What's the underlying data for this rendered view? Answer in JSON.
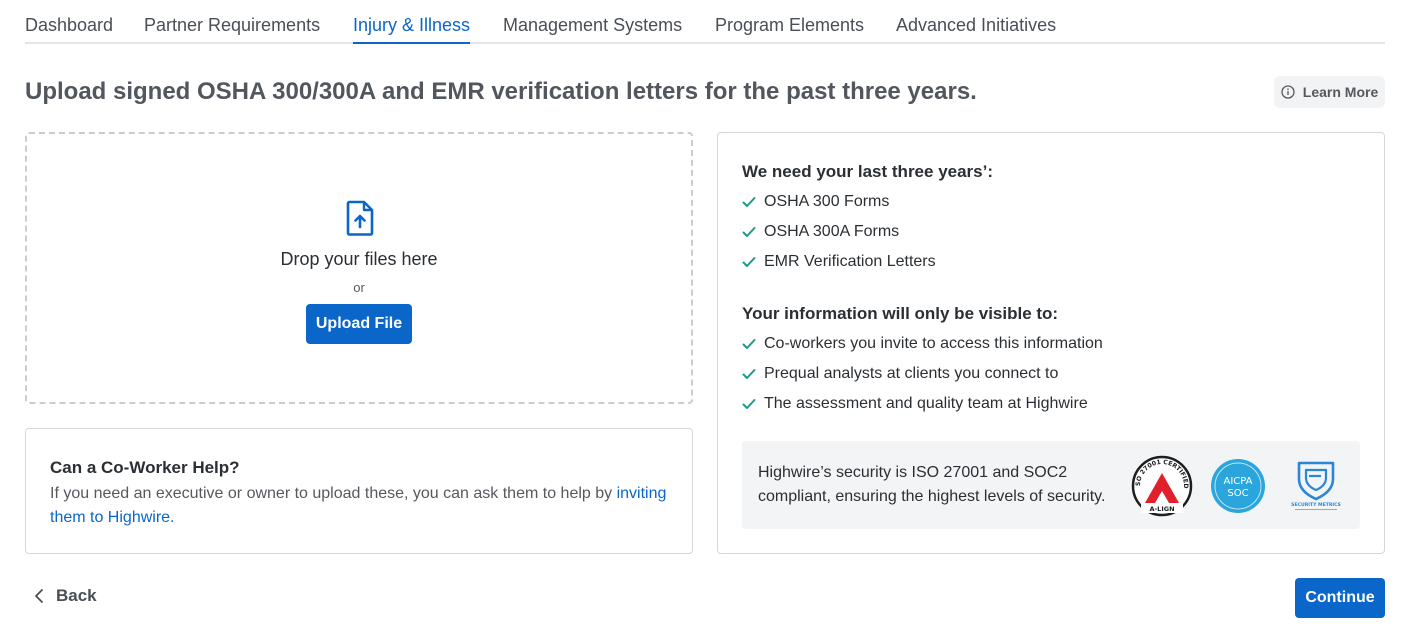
{
  "tabs": [
    {
      "label": "Dashboard",
      "active": false
    },
    {
      "label": "Partner Requirements",
      "active": false
    },
    {
      "label": "Injury & Illness",
      "active": true
    },
    {
      "label": "Management Systems",
      "active": false
    },
    {
      "label": "Program Elements",
      "active": false
    },
    {
      "label": "Advanced Initiatives",
      "active": false
    }
  ],
  "page_title": "Upload signed OSHA 300/300A and EMR verification letters for the past three years.",
  "learn_more": {
    "label": "Learn More",
    "icon": "info-circle-icon"
  },
  "dropzone": {
    "icon": "file-upload-icon",
    "drop_text": "Drop your files here",
    "or_text": "or",
    "upload_label": "Upload File"
  },
  "coworker": {
    "title": "Can a Co-Worker Help?",
    "body": "If you need an executive or owner to upload these, you can ask them to help by ",
    "link_text": "inviting them to Highwire."
  },
  "requirements": {
    "heading": "We need your last three years’:",
    "items": [
      "OSHA 300 Forms",
      "OSHA 300A Forms",
      "EMR Verification Letters"
    ]
  },
  "visibility": {
    "heading": "Your information will only be visible to:",
    "items": [
      "Co-workers you invite to access this information",
      "Prequal analysts at clients you connect to",
      "The assessment and quality team at Highwire"
    ]
  },
  "security": {
    "text": "Highwire’s security is ISO 27001 and SOC2 compliant, ensuring the highest levels of security.",
    "badges": {
      "iso": {
        "top_text": "ISO 27001 CERTIFIED",
        "bottom_text": "A-LIGN"
      },
      "aicpa": {
        "line1": "AICPA",
        "line2": "SOC"
      },
      "shield": {
        "text": "SECURITY METRICS"
      }
    }
  },
  "footer": {
    "back_label": "Back",
    "continue_label": "Continue"
  },
  "colors": {
    "accent": "#0a66c9",
    "check": "#1a9a8a"
  }
}
